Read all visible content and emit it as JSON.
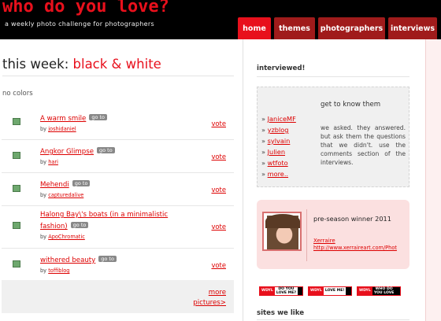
{
  "header": {
    "title": "who do you love?",
    "tagline": "a weekly photo challenge for photographers",
    "nav": [
      {
        "label": "home",
        "active": true
      },
      {
        "label": "themes",
        "active": false
      },
      {
        "label": "photographers",
        "active": false
      },
      {
        "label": "interviews",
        "active": false
      }
    ]
  },
  "main": {
    "heading_prefix": "this week:",
    "theme": "black & white",
    "description": "no colors",
    "goto_label": "go to",
    "by_label": "by",
    "vote_label": "vote",
    "entries": [
      {
        "title": "A warm smile",
        "author": "joshidaniel"
      },
      {
        "title": "Angkor Glimpse",
        "author": "hari"
      },
      {
        "title": "Mehendi",
        "author": "capturedalive"
      },
      {
        "title": "Halong Bay\\'s boats (in a minimalistic",
        "title_line2": "fashion)",
        "author": "ApoChromatic"
      },
      {
        "title": "withered beauty",
        "author": "toffiblog"
      }
    ],
    "more_line1": "more",
    "more_line2": "pictures>"
  },
  "sidebar": {
    "interviewed_heading": "interviewed!",
    "interviewees": [
      "JaniceMF",
      "yzblog",
      "sylvain",
      "Julien",
      "wtfoto",
      "more.."
    ],
    "get_to_know_title": "get to know them",
    "get_to_know_text": "we asked. they answered. but ask them the questions that we didn't. use the comments section of the interviews.",
    "winner_title": "pre-season winner 2011",
    "winner_name": "Xerraire",
    "winner_url": "http://www.xerraireart.com/Phot",
    "badges": [
      {
        "tag": "WDYL",
        "text_line1": "DO YOU",
        "text_line2": "LOVE ME?"
      },
      {
        "tag": "WDYL",
        "text_line1": "LOVE ME!",
        "text_line2": ""
      },
      {
        "tag": "WDYL",
        "text_line1": "WHO DO",
        "text_line2": "YOU LOVE"
      }
    ],
    "sites_heading": "sites we like"
  },
  "colors": {
    "accent": "#e8101c",
    "tab_inactive": "#a01b1b",
    "header_bg": "#000000",
    "link": "#dd0000",
    "winner_bg": "#fbe0e0"
  }
}
